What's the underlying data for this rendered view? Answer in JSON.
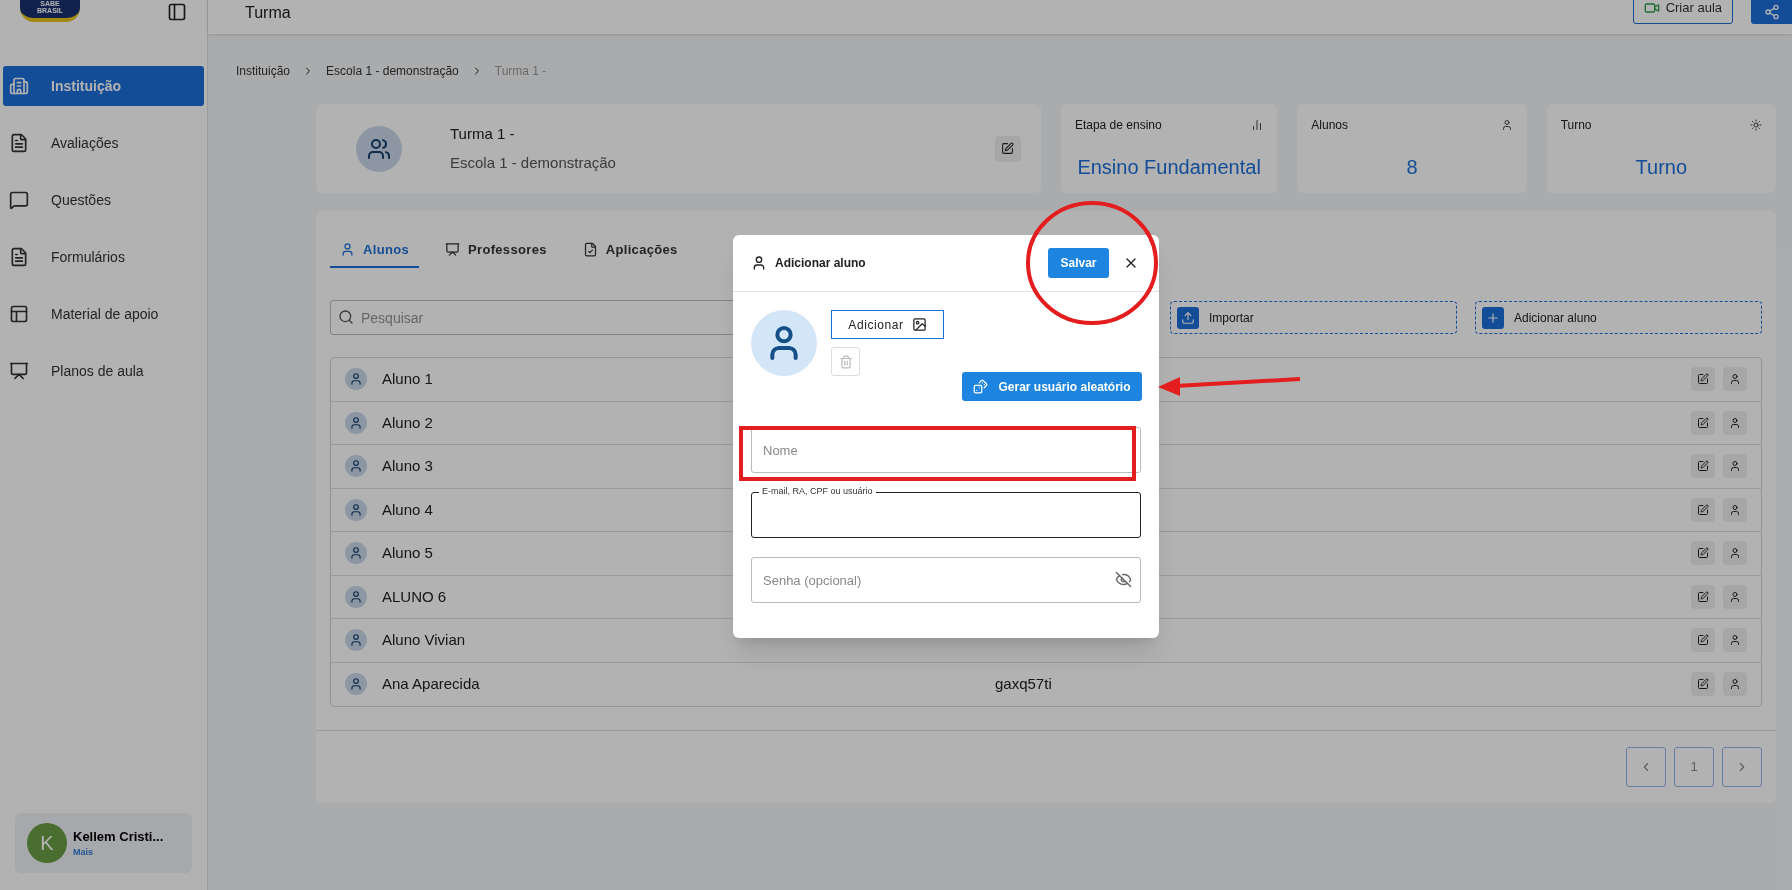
{
  "logo": {
    "text": "SABE BRASIL"
  },
  "header": {
    "title": "Turma",
    "create_button": "Criar aula"
  },
  "sidebar": {
    "items": [
      {
        "label": "Instituição",
        "kind": "building",
        "selected": true
      },
      {
        "label": "Avaliações",
        "kind": "document",
        "selected": false
      },
      {
        "label": "Questões",
        "kind": "chat",
        "selected": false
      },
      {
        "label": "Formulários",
        "kind": "document",
        "selected": false
      },
      {
        "label": "Material de apoio",
        "kind": "layout",
        "selected": false
      },
      {
        "label": "Planos de aula",
        "kind": "presentation",
        "selected": false
      }
    ],
    "user": {
      "initial": "K",
      "name": "Kellem Cristi...",
      "link": "Mais"
    }
  },
  "breadcrumb": [
    "Instituição",
    "Escola 1 - demonstração",
    "Turma 1 -"
  ],
  "class_card": {
    "title": "Turma 1 -",
    "subtitle": "Escola 1 - demonstração"
  },
  "stats": [
    {
      "label": "Etapa de ensino",
      "value": "Ensino Fundamental",
      "kind": "chart"
    },
    {
      "label": "Alunos",
      "value": "8",
      "kind": "person"
    },
    {
      "label": "Turno",
      "value": "Turno",
      "kind": "sun"
    }
  ],
  "tabs": [
    {
      "label": "Alunos",
      "kind": "person",
      "selected": true
    },
    {
      "label": "Professores",
      "kind": "presentation",
      "selected": false
    },
    {
      "label": "Aplicações",
      "kind": "check",
      "selected": false
    }
  ],
  "search": {
    "placeholder": "Pesquisar"
  },
  "actions": [
    {
      "label": "Importar",
      "kind": "upload"
    },
    {
      "label": "Adicionar aluno",
      "kind": "plus"
    }
  ],
  "students": [
    {
      "name": "Aluno 1"
    },
    {
      "name": "Aluno 2"
    },
    {
      "name": "Aluno 3"
    },
    {
      "name": "Aluno 4"
    },
    {
      "name": "Aluno 5"
    },
    {
      "name": "ALUNO 6"
    },
    {
      "name": "Aluno Vivian"
    },
    {
      "name": "Ana Aparecida",
      "username": "gaxq57ti"
    }
  ],
  "pagination": {
    "page": "1"
  },
  "modal": {
    "title": "Adicionar aluno",
    "save": "Salvar",
    "add_photo": "Adicionar",
    "random_user": "Gerar usuário aleatório",
    "fields": [
      {
        "kind": "text",
        "placeholder": "Nome",
        "focused": false
      },
      {
        "kind": "text",
        "label": "E-mail, RA, CPF ou usuário",
        "focused": true
      },
      {
        "kind": "password",
        "placeholder": "Senha (opcional)",
        "focused": false
      }
    ]
  }
}
